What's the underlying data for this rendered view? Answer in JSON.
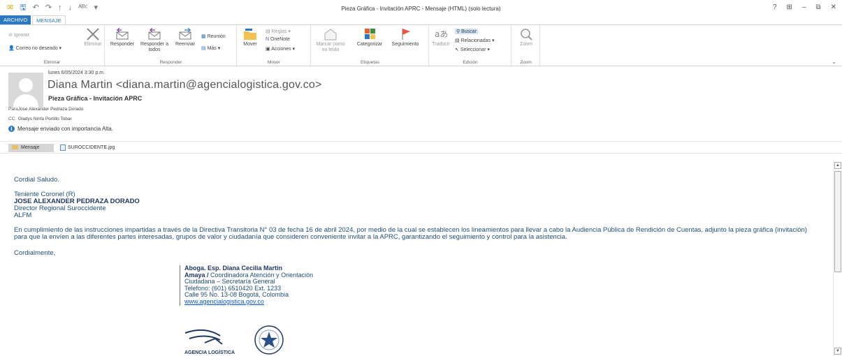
{
  "window": {
    "title": "Pieza Gráfica - Invitación APRC - Mensaje (HTML) (solo lectura)",
    "controls": [
      "?",
      "⊞",
      "–",
      "⧉",
      "✕"
    ]
  },
  "tabs": [
    "ARCHIVO",
    "MENSAJE"
  ],
  "ribbon": {
    "eliminar": {
      "label": "Eliminar",
      "ignorar": "Ignorar",
      "correo_no_deseado": "Correo no deseado",
      "eliminar_btn": "Eliminar"
    },
    "responder": {
      "label": "Responder",
      "responder": "Responder",
      "responder_todos": "Responder a todos",
      "reenviar": "Reenviar",
      "reunion": "Reunión",
      "mas": "Más"
    },
    "mover": {
      "label": "Mover",
      "mover": "Mover",
      "reglas": "Reglas",
      "onenote": "OneNote",
      "acciones": "Acciones"
    },
    "etiquetas": {
      "label": "Etiquetas",
      "marcar": "Marcar como no leído",
      "categorizar": "Categorizar",
      "seguimiento": "Seguimiento"
    },
    "edicion": {
      "label": "Edición",
      "traducir": "Traducir",
      "buscar": "Buscar",
      "relacionadas": "Relacionadas",
      "seleccionar": "Seleccionar"
    },
    "zoom": {
      "label": "Zoom",
      "zoom": "Zoom"
    }
  },
  "header": {
    "date": "lunes 6/05/2024 3:30 p.m.",
    "from": "Diana Martin <diana.martin@agencialogistica.gov.co>",
    "subject": "Pieza Gráfica - Invitación APRC",
    "to_label": "Para",
    "to": "Jose Alexander Pedraza Dorado",
    "cc_label": "CC",
    "cc": "Gladys Ninfa Portillo Tobar",
    "importance": "Mensaje enviado con importancia Alta."
  },
  "attachments": {
    "message_tab": "Mensaje",
    "file": "SUROCCIDENTE.jpg"
  },
  "body": {
    "greeting": "Cordial Saludo.",
    "rank": "Teniente Coronel (R)",
    "name": "JOSE ALEXANDER PEDRAZA DORADO",
    "position": "Director Regional Suroccidente",
    "org": "ALFM",
    "paragraph": "En cumplimiento de las instrucciones impartidas a través de la Directiva Transitoria N° 03 de fecha 16 de abril 2024, por medio de la cual se establecen los lineamientos para llevar a cabo la Audiencia Pública de Rendición de Cuentas, adjunto la pieza gráfica (invitación) para que la envíen a las diferentes partes interesadas, grupos de valor y ciudadanía que consideren conveniente invitar a la APRC, garantizando el seguimiento y control para la asistencia.",
    "closing": "Cordialmente,",
    "signature": {
      "name_line1": "Aboga. Esp. Diana Cecilia Martin",
      "name_line2": "Amaya /",
      "role": "Coordinadora Atención y Orientación Ciudadana – Secretaría General",
      "phone": "Telefono: (601) 6510420 Ext. 1233",
      "address": "Calle 95 No. 13-08 Bogotá, Colombia",
      "web": "www.agencialogistica.gov.co",
      "logo_text": "AGENCIA LOGÍSTICA"
    }
  }
}
